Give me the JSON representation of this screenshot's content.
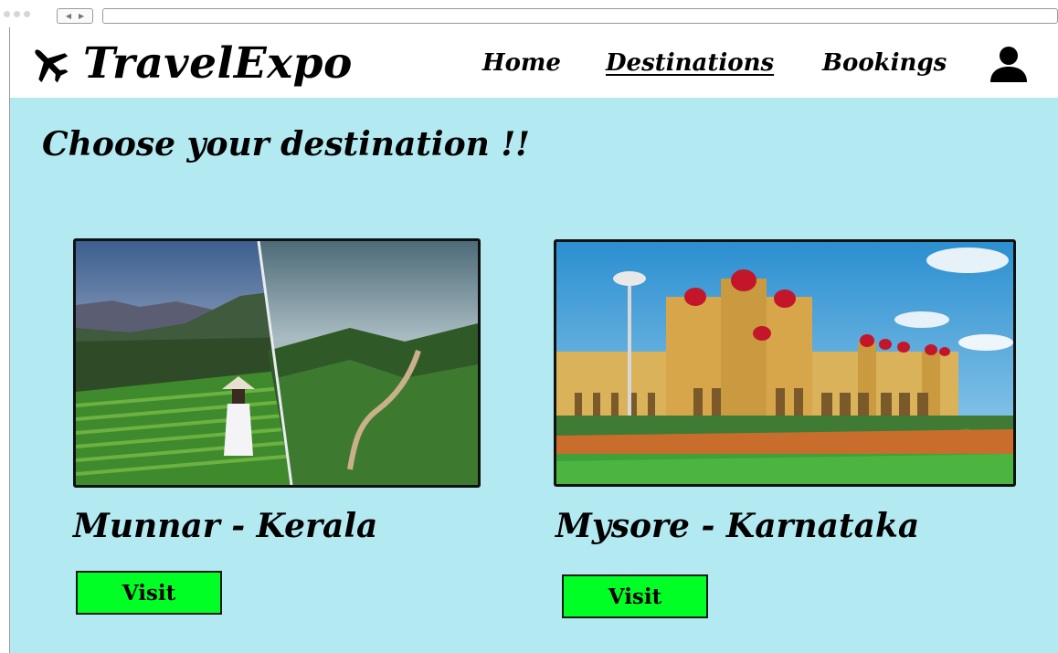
{
  "window": {
    "controls": [
      "close-dot",
      "minimize-dot",
      "zoom-dot"
    ],
    "nav_arrows": "◀ ▶"
  },
  "header": {
    "brand": "TravelExpo",
    "logo_icon": "airplane-icon",
    "nav": {
      "home": "Home",
      "destinations": "Destinations",
      "bookings": "Bookings"
    },
    "active_nav": "destinations",
    "user_icon": "user-icon"
  },
  "main": {
    "title": "Choose your destination !!",
    "background": "#b3e9f1",
    "destinations": [
      {
        "name": "Munnar - Kerala",
        "button": "Visit",
        "image": "tea-plantation-mountains-photo"
      },
      {
        "name": "Mysore - Karnataka",
        "button": "Visit",
        "image": "mysore-palace-photo"
      }
    ],
    "button_color": "#00ff24"
  }
}
